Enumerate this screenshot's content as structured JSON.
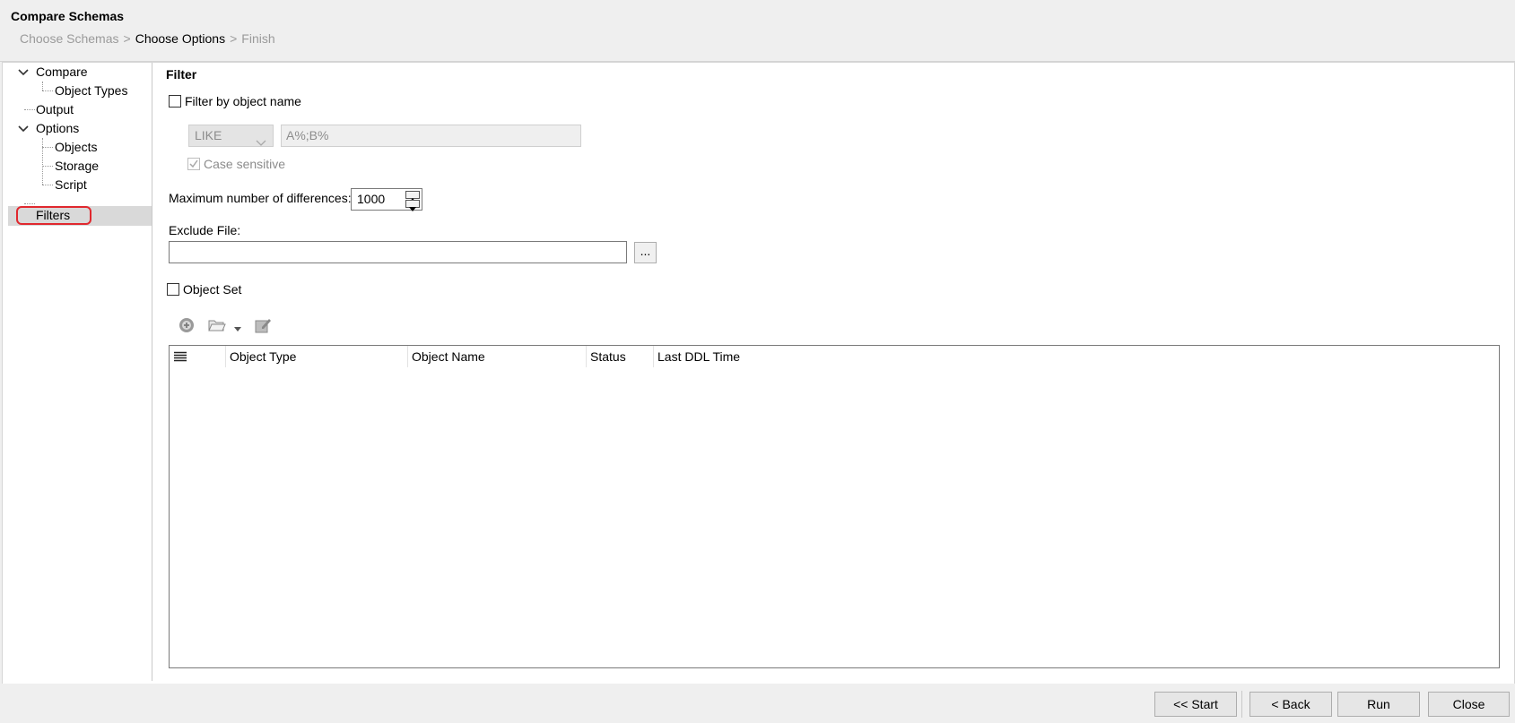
{
  "window": {
    "title": "Compare Schemas",
    "breadcrumb": {
      "step1": "Choose Schemas",
      "step2": "Choose Options",
      "step3": "Finish",
      "separator": ">"
    }
  },
  "nav": {
    "items": [
      {
        "label": "Compare",
        "expanded": true
      },
      {
        "label": "Object Types"
      },
      {
        "label": "Output"
      },
      {
        "label": "Options",
        "expanded": true
      },
      {
        "label": "Objects"
      },
      {
        "label": "Storage"
      },
      {
        "label": "Script"
      },
      {
        "label": "Filters",
        "selected": true
      }
    ]
  },
  "filter": {
    "section_title": "Filter",
    "filter_by_name_label": "Filter by object name",
    "filter_by_name_checked": false,
    "operator_value": "LIKE",
    "pattern_value": "A%;B%",
    "case_sensitive_label": "Case sensitive",
    "case_sensitive_checked": true,
    "max_diff_label": "Maximum number of differences:",
    "max_diff_value": "1000",
    "exclude_file_label": "Exclude File:",
    "exclude_file_value": "",
    "browse_label": "...",
    "object_set_label": "Object Set",
    "object_set_checked": false
  },
  "grid": {
    "columns": [
      "Object Type",
      "Object Name",
      "Status",
      "Last DDL Time"
    ]
  },
  "footer": {
    "start_label": "<< Start",
    "back_label": "< Back",
    "run_label": "Run",
    "close_label": "Close"
  },
  "colors": {
    "highlight_outline": "#e0282e",
    "selected_bg": "#d9d9d9"
  }
}
